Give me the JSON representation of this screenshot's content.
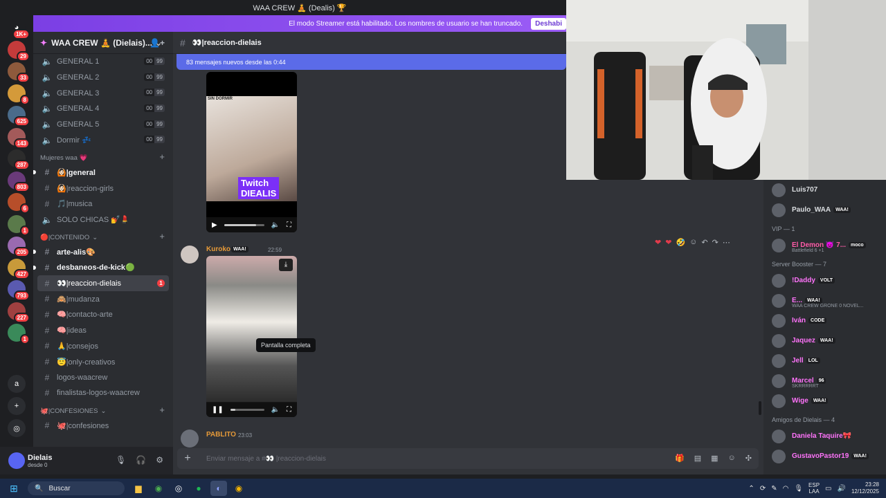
{
  "window": {
    "title": "WAA CREW 🧘 (Dealis) 🏆"
  },
  "streamer_banner": {
    "text": "El modo Streamer está habilitado. Los nombres de usuario se han truncado.",
    "button": "Deshabi"
  },
  "server": {
    "name": "WAA CREW 🧘 (Dielais)..."
  },
  "rail_badges": [
    "1K+",
    "29",
    "33",
    "8",
    "625",
    "143",
    "287",
    "803",
    "6",
    "1",
    "205",
    "427",
    "793",
    "227",
    "1"
  ],
  "voice_channels": [
    {
      "name": "GENERAL 1",
      "a": "00",
      "b": "99"
    },
    {
      "name": "GENERAL 2",
      "a": "00",
      "b": "99"
    },
    {
      "name": "GENERAL 3",
      "a": "00",
      "b": "99"
    },
    {
      "name": "GENERAL 4",
      "a": "00",
      "b": "99"
    },
    {
      "name": "GENERAL 5",
      "a": "00",
      "b": "99"
    },
    {
      "name": "Dormir 💤",
      "a": "00",
      "b": "99"
    }
  ],
  "cat_mujeres": "Mujeres waa 💗",
  "mujeres_channels": [
    "🙆🏻|general",
    "🙆🏻|reaccion-girls",
    "🎵|musica",
    "SOLO CHICAS 💅💄"
  ],
  "cat_contenido": "🔴|CONTENIDO",
  "contenido_channels": [
    "arte-alis🎨",
    "desbaneos-de-kick🟢",
    "👀|reaccion-dielais",
    "🙈|mudanza",
    "🧠|contacto-arte",
    "🧠|ideas",
    "🙏|consejos",
    "😇|only-creativos",
    "logos-waacrew",
    "finalistas-logos-waacrew"
  ],
  "unread_count": "1",
  "cat_confesiones": "🐙|CONFESIONES",
  "confesiones_channels": [
    "🐙|confesiones"
  ],
  "user": {
    "name": "Dielais",
    "status": "desde 0"
  },
  "chat": {
    "channel": "👀|reaccion-dielais",
    "new_messages": "83 mensajes nuevos desde las 0:44",
    "video1_caption_top": "SIN DORMIR",
    "video1_brand_1": "Twitch",
    "video1_brand_2": "DIEALIS",
    "msg1_author": "Kuroko",
    "msg1_tag": "WAA!",
    "msg1_time": "22:59",
    "tooltip": "Pantalla completa",
    "msg2_author": "PABLITO",
    "msg2_time": "23:03",
    "composer_placeholder": "Enviar mensaje a #👀 |reaccion-dielais"
  },
  "members": {
    "top": [
      {
        "name": "Luis707",
        "color": "#dbdee1"
      },
      {
        "name": "Paulo_WAA",
        "color": "#dbdee1",
        "tag": "WAA!"
      }
    ],
    "vip_header": "VIP — 1",
    "vip": [
      {
        "name": "El Demon 👿 7...",
        "color": "#ff5ca8",
        "tag": "moco",
        "sub": "Battlefield 6 +1"
      }
    ],
    "booster_header": "Server Booster — 7",
    "boosters": [
      {
        "name": "!Daddy",
        "color": "#ff73fa",
        "tag": "VOLT"
      },
      {
        "name": "E...",
        "color": "#ff73fa",
        "tag": "WAA!",
        "sub": "WAA CREW GRONE 0 NOVEL..."
      },
      {
        "name": "Iván",
        "color": "#ff73fa",
        "tag": "CODE"
      },
      {
        "name": "Jaquez",
        "color": "#ff73fa",
        "tag": "WAA!"
      },
      {
        "name": "Jell",
        "color": "#ff73fa",
        "tag": "LOL"
      },
      {
        "name": "Marcel",
        "color": "#ff73fa",
        "tag": "96",
        "sub": "SKRRRRRT"
      },
      {
        "name": "Wige",
        "color": "#ff73fa",
        "tag": "WAA!"
      }
    ],
    "friends_header": "Amigos de Dielais — 4",
    "friends": [
      {
        "name": "Daniela Taquire🎀",
        "color": "#ff73fa"
      },
      {
        "name": "GustavoPastor19",
        "color": "#ff73fa",
        "tag": "WAA!"
      }
    ]
  },
  "taskbar": {
    "search": "Buscar",
    "lang_1": "ESP",
    "lang_2": "LAA",
    "time": "23:28",
    "date": "12/12/2025"
  }
}
